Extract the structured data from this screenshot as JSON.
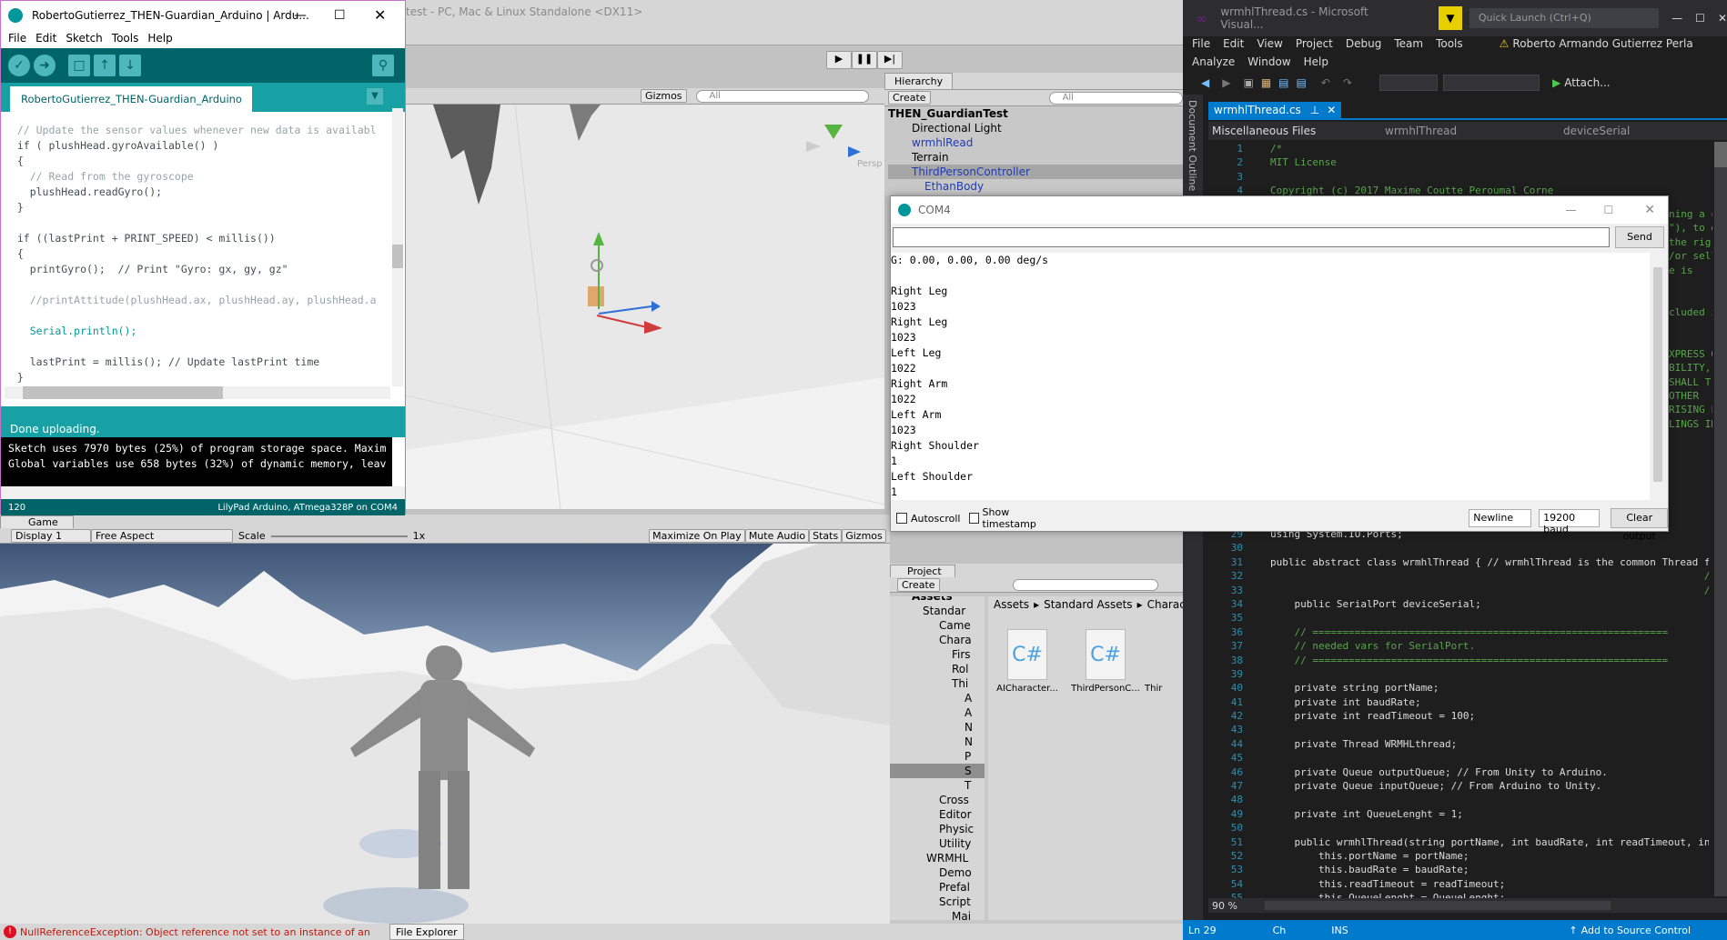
{
  "unity": {
    "title": "test - PC, Mac & Linux Standalone <DX11>",
    "hierarchy": {
      "tab": "Hierarchy",
      "create": "Create",
      "search": "All",
      "items": [
        "THEN_GuardianTest",
        "Directional Light",
        "wrmhlRead",
        "Terrain",
        "ThirdPersonController",
        "EthanBody"
      ]
    },
    "scene": {
      "gizmos": "Gizmos",
      "search": "All",
      "persp": "Persp"
    },
    "game": {
      "tab": "Game",
      "display": "Display 1",
      "aspect": "Free Aspect",
      "scale_label": "Scale",
      "scale_value": "1x",
      "maximize": "Maximize On Play",
      "mute": "Mute Audio",
      "stats": "Stats",
      "gizmos": "Gizmos"
    },
    "project": {
      "tab": "Project",
      "create": "Create",
      "breadcrumb": [
        "Assets",
        "Standard Assets",
        "Charac"
      ],
      "tree": [
        "Assets",
        "Standar",
        "Came",
        "Chara",
        "Firs",
        "Rol",
        "Thi",
        "A",
        "A",
        "N",
        "N",
        "P",
        "S",
        "T",
        "Cross",
        "Editor",
        "Physic",
        "Utility",
        "WRMHL",
        "Demo",
        "Prefal",
        "Script",
        "Mai"
      ],
      "files": [
        "AICharacter...",
        "ThirdPersonC...",
        "Thir"
      ]
    },
    "status": "NullReferenceException: Object reference not set to an instance of an",
    "file_explorer": "File Explorer"
  },
  "arduino": {
    "title": "RobertoGutierrez_THEN-Guardian_Arduino | Ardu...",
    "menu": [
      "File",
      "Edit",
      "Sketch",
      "Tools",
      "Help"
    ],
    "tab": "RobertoGutierrez_THEN-Guardian_Arduino",
    "code": [
      "  // Update the sensor values whenever new data is availabl",
      "  if ( plushHead.gyroAvailable() )",
      "  {",
      "    // Read from the gyroscope",
      "    plushHead.readGyro();",
      "  }",
      "",
      "  if ((lastPrint + PRINT_SPEED) < millis())",
      "  {",
      "    printGyro();  // Print \"Gyro: gx, gy, gz\"",
      "",
      "    //printAttitude(plushHead.ax, plushHead.ay, plushHead.a",
      "",
      "    Serial.println();",
      "",
      "    lastPrint = millis(); // Update lastPrint time",
      "  }"
    ],
    "status": "Done uploading.",
    "console": [
      "Sketch uses 7970 bytes (25%) of program storage space. Maxim",
      "Global variables use 658 bytes (32%) of dynamic memory, leav"
    ],
    "line": "120",
    "board": "LilyPad Arduino, ATmega328P on COM4"
  },
  "serial": {
    "title": "COM4",
    "send": "Send",
    "output": [
      "G: 0.00, 0.00, 0.00 deg/s",
      "",
      "Right Leg",
      "1023",
      "Right Leg",
      "1023",
      "Left Leg",
      "1022",
      "Right Arm",
      "1022",
      "Left Arm",
      "1023",
      "Right Shoulder",
      "1",
      "Left Shoulder",
      "1"
    ],
    "autoscroll": "Autoscroll",
    "timestamp": "Show timestamp",
    "newline": "Newline",
    "baud": "19200 baud",
    "clear": "Clear output"
  },
  "vs": {
    "title": "wrmhlThread.cs - Microsoft Visual...",
    "quick_launch": "Quick Launch (Ctrl+Q)",
    "menu1": [
      "File",
      "Edit",
      "View",
      "Project",
      "Debug",
      "Team",
      "Tools"
    ],
    "menu2": [
      "Analyze",
      "Window",
      "Help"
    ],
    "user": "Roberto Armando Gutierrez Perla",
    "attach": "Attach...",
    "doc_outline": "Document Outline",
    "tab": "wrmhlThread.cs",
    "nav": [
      "Miscellaneous Files",
      "wrmhlThread",
      "deviceSerial"
    ],
    "top_lines": [
      [
        "1",
        "/*"
      ],
      [
        "2",
        "MIT License"
      ],
      [
        "3",
        ""
      ],
      [
        "4",
        "Copyright (c) 2017 Maxime Coutte Peroumal Corne"
      ]
    ],
    "right_frag": [
      "ning a c",
      "\"), to d",
      "the rig",
      "/or sell",
      "e is",
      "",
      "",
      "cluded i",
      "",
      "",
      "XPRESS O",
      "BILITY,",
      "SHALL T",
      "OTHER",
      "RISING F",
      "LINGS IN"
    ],
    "zoom": "90 %",
    "ln": "Ln 29",
    "col": "Ch",
    "ins": "INS",
    "source_control": "Add to Source Control",
    "code": [
      [
        "29",
        "using System.IO.Ports;"
      ],
      [
        "30",
        ""
      ],
      [
        "31",
        "public abstract class wrmhlThread { // wrmhlThread is the common Thread f"
      ],
      [
        "32",
        "                                                                        /"
      ],
      [
        "33",
        "                                                                        /"
      ],
      [
        "34",
        "    public SerialPort deviceSerial;"
      ],
      [
        "35",
        ""
      ],
      [
        "36",
        "    // ==========================================================="
      ],
      [
        "37",
        "    // needed vars for SerialPort."
      ],
      [
        "38",
        "    // ==========================================================="
      ],
      [
        "39",
        ""
      ],
      [
        "40",
        "    private string portName;"
      ],
      [
        "41",
        "    private int baudRate;"
      ],
      [
        "42",
        "    private int readTimeout = 100;"
      ],
      [
        "43",
        ""
      ],
      [
        "44",
        "    private Thread WRMHLthread;"
      ],
      [
        "45",
        ""
      ],
      [
        "46",
        "    private Queue outputQueue; // From Unity to Arduino."
      ],
      [
        "47",
        "    private Queue inputQueue; // From Arduino to Unity."
      ],
      [
        "48",
        ""
      ],
      [
        "49",
        "    private int QueueLenght = 1;"
      ],
      [
        "50",
        ""
      ],
      [
        "51",
        "    public wrmhlThread(string portName, int baudRate, int readTimeout, in"
      ],
      [
        "52",
        "        this.portName = portName;"
      ],
      [
        "53",
        "        this.baudRate = baudRate;"
      ],
      [
        "54",
        "        this.readTimeout = readTimeout;"
      ],
      [
        "55",
        "        this.QueueLenght = QueueLenght;"
      ]
    ]
  }
}
